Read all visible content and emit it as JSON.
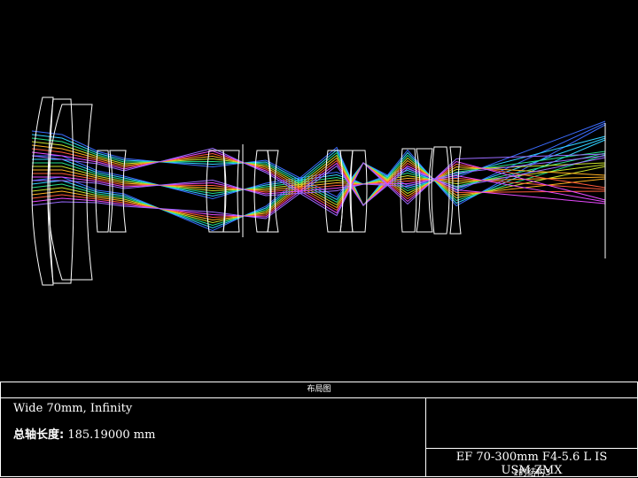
{
  "panel": {
    "title": "布局图",
    "description_line1": "Wide 70mm, Infinity",
    "total_length_label": "总轴长度:",
    "total_length_value": "185.19000 mm",
    "file_name": "EF 70-300mm F4-5.6 L IS USM.ZMX",
    "config_label": "1的结构3"
  },
  "colors": {
    "background": "#000000",
    "lens_outline": "#ffffff",
    "rays": [
      "#3b6cff",
      "#2fd0ff",
      "#25e08a",
      "#c8e02a",
      "#ffb020",
      "#ff5a3a",
      "#e84aff",
      "#9a6bff"
    ]
  }
}
